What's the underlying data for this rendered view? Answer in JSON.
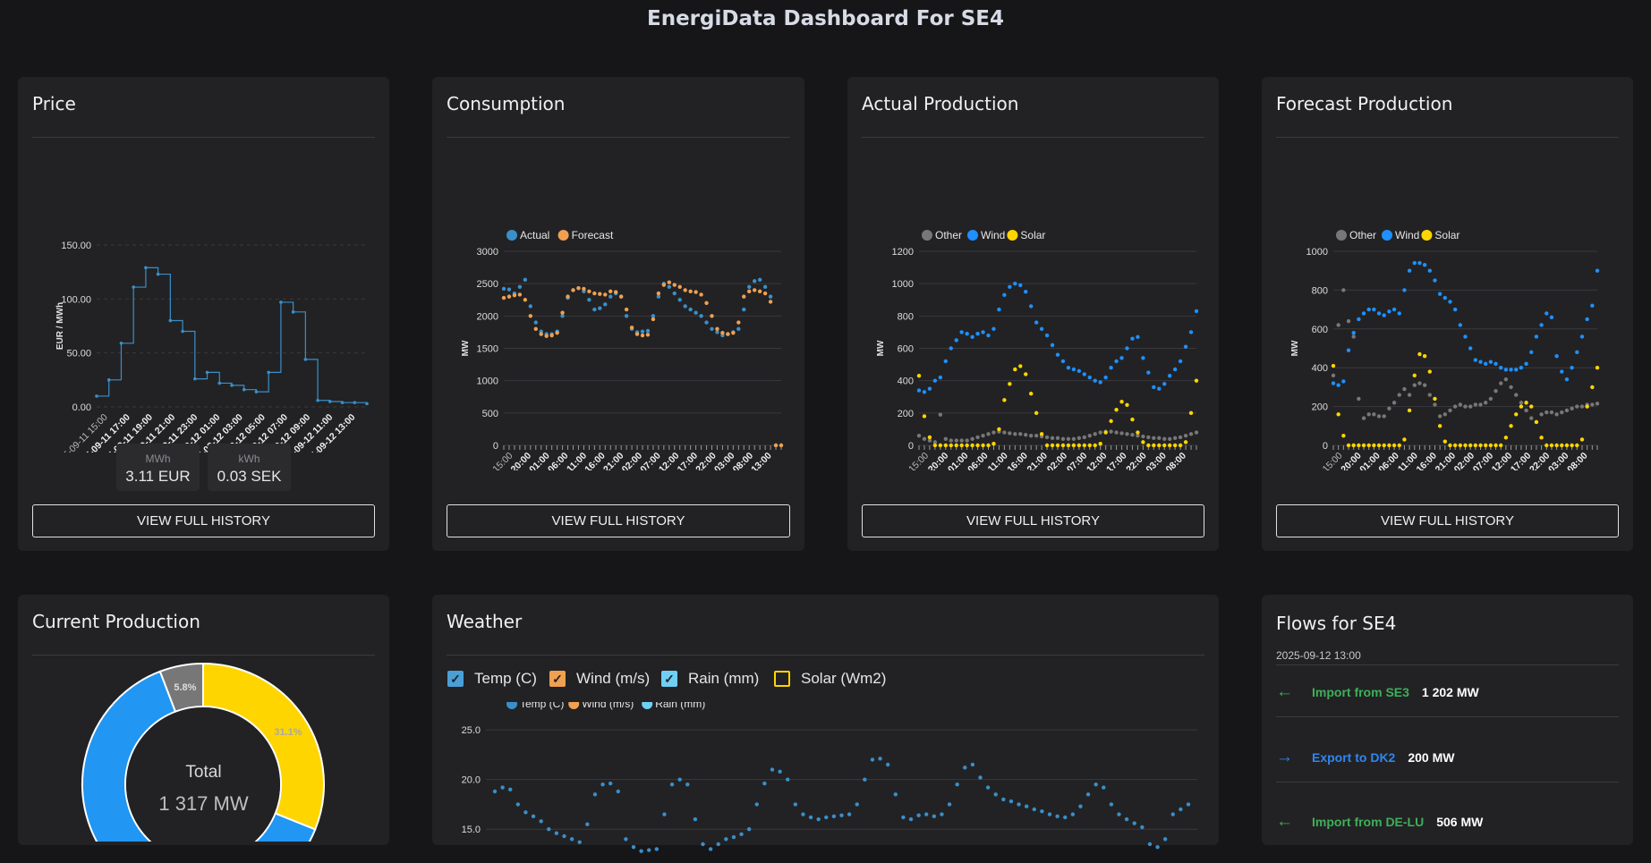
{
  "page": {
    "title": "EnergiData Dashboard For SE4"
  },
  "actions": {
    "history_label": "VIEW FULL HISTORY"
  },
  "colors": {
    "background": "#161618",
    "card": "#222224",
    "series_blue": "#1e90ff",
    "price_blue": "#3a8fc9",
    "forecast_orange": "#f0a050",
    "solar_yellow": "#ffd500",
    "other_gray": "#777777",
    "import_green": "#3fae5a",
    "export_blue": "#2f86f0"
  },
  "price": {
    "title": "Price",
    "boxes": [
      {
        "unit": "MWh",
        "value": "3.11 EUR"
      },
      {
        "unit": "kWh",
        "value": "0.03 SEK"
      }
    ],
    "chart_data": {
      "type": "line",
      "title": "Price",
      "ylabel": "EUR / MWh",
      "ylim": [
        0,
        150
      ],
      "y_ticks": [
        "0.00",
        "50.00",
        "100.00",
        "150.00"
      ],
      "x_ticks": [
        "2025-09-11 15:00",
        "2025-09-11 17:00",
        "2025-09-11 19:00",
        "2025-09-11 21:00",
        "2025-09-11 23:00",
        "2025-09-12 01:00",
        "2025-09-12 03:00",
        "2025-09-12 05:00",
        "2025-09-12 07:00",
        "2025-09-12 09:00",
        "2025-09-12 11:00",
        "2025-09-12 13:00"
      ],
      "step": true,
      "values": [
        10,
        25,
        59,
        111,
        129,
        123,
        80,
        70,
        26,
        32,
        22,
        20,
        16,
        14,
        32,
        97,
        88,
        44,
        6,
        5,
        4,
        4,
        3
      ]
    }
  },
  "consumption": {
    "title": "Consumption",
    "chart_data": {
      "type": "scatter",
      "title": "Consumption",
      "ylabel": "MW",
      "ylim": [
        0,
        3000
      ],
      "y_ticks": [
        "0",
        "500",
        "1000",
        "1500",
        "2000",
        "2500",
        "3000"
      ],
      "x_ticks": [
        "2025-09-09 15:00",
        "2025-09-09 20:00",
        "2025-09-10 01:00",
        "2025-09-10 06:00",
        "2025-09-10 11:00",
        "2025-09-10 16:00",
        "2025-09-10 21:00",
        "2025-09-11 02:00",
        "2025-09-11 07:00",
        "2025-09-11 12:00",
        "2025-09-11 17:00",
        "2025-09-11 22:00",
        "2025-09-12 03:00",
        "2025-09-12 08:00",
        "2025-09-12 13:00"
      ],
      "series": [
        {
          "name": "Actual",
          "color": "#3a8fc9",
          "values": [
            2420,
            2410,
            2350,
            2450,
            2560,
            2150,
            1900,
            1760,
            1720,
            1720,
            1760,
            2000,
            2280,
            2400,
            2430,
            2380,
            2250,
            2100,
            2120,
            2180,
            2300,
            2350,
            2300,
            2000,
            1800,
            1750,
            1760,
            1770,
            2000,
            2300,
            2500,
            2450,
            2350,
            2250,
            2150,
            2100,
            2050,
            2000,
            1900,
            1800,
            1750,
            1700,
            1720,
            1750,
            1800,
            2100,
            2450,
            2540,
            2560,
            2450,
            2300,
            0,
            0
          ]
        },
        {
          "name": "Forecast",
          "color": "#f0a050",
          "values": [
            2280,
            2300,
            2320,
            2330,
            2250,
            2000,
            1800,
            1720,
            1690,
            1700,
            1740,
            2050,
            2300,
            2400,
            2430,
            2420,
            2380,
            2350,
            2340,
            2330,
            2380,
            2370,
            2300,
            2100,
            1820,
            1720,
            1700,
            1710,
            1950,
            2350,
            2480,
            2520,
            2480,
            2450,
            2400,
            2380,
            2370,
            2330,
            2200,
            2000,
            1800,
            1740,
            1720,
            1740,
            1900,
            2300,
            2380,
            2400,
            2380,
            2350,
            2220,
            0,
            0
          ]
        }
      ]
    }
  },
  "actual_production": {
    "title": "Actual Production",
    "chart_data": {
      "type": "scatter",
      "title": "Actual Production",
      "ylabel": "MW",
      "ylim": [
        0,
        1200
      ],
      "y_ticks": [
        "0",
        "200",
        "400",
        "600",
        "800",
        "1000",
        "1200"
      ],
      "x_ticks": [
        "2025-09-09 15:00",
        "2025-09-09 20:00",
        "2025-09-10 01:00",
        "2025-09-10 06:00",
        "2025-09-10 11:00",
        "2025-09-10 16:00",
        "2025-09-10 21:00",
        "2025-09-11 02:00",
        "2025-09-11 07:00",
        "2025-09-11 12:00",
        "2025-09-11 17:00",
        "2025-09-11 22:00",
        "2025-09-12 03:00",
        "2025-09-12 08:00"
      ],
      "series": [
        {
          "name": "Other",
          "color": "#777777",
          "values": [
            60,
            40,
            30,
            20,
            190,
            40,
            30,
            30,
            30,
            30,
            40,
            50,
            60,
            70,
            80,
            85,
            80,
            75,
            70,
            70,
            65,
            60,
            60,
            55,
            50,
            45,
            45,
            40,
            40,
            40,
            45,
            50,
            60,
            70,
            80,
            85,
            85,
            80,
            75,
            70,
            65,
            60,
            55,
            50,
            45,
            45,
            40,
            40,
            45,
            50,
            60,
            70,
            80
          ]
        },
        {
          "name": "Wind",
          "color": "#1e90ff",
          "values": [
            340,
            330,
            350,
            400,
            420,
            520,
            600,
            650,
            700,
            690,
            670,
            690,
            700,
            680,
            720,
            840,
            930,
            980,
            1000,
            990,
            950,
            860,
            760,
            720,
            680,
            620,
            560,
            520,
            480,
            470,
            460,
            440,
            420,
            400,
            390,
            420,
            480,
            520,
            540,
            600,
            660,
            670,
            540,
            450,
            360,
            350,
            380,
            430,
            470,
            520,
            610,
            700,
            830
          ]
        },
        {
          "name": "Solar",
          "color": "#ffd500",
          "values": [
            430,
            180,
            50,
            0,
            0,
            0,
            0,
            0,
            0,
            0,
            0,
            0,
            0,
            0,
            10,
            100,
            280,
            380,
            470,
            490,
            440,
            320,
            200,
            70,
            0,
            0,
            0,
            0,
            0,
            0,
            0,
            0,
            0,
            0,
            10,
            80,
            150,
            220,
            270,
            250,
            160,
            80,
            20,
            0,
            0,
            0,
            0,
            0,
            0,
            0,
            20,
            200,
            400
          ]
        }
      ]
    }
  },
  "forecast_production": {
    "title": "Forecast Production",
    "chart_data": {
      "type": "scatter",
      "title": "Forecast Production",
      "ylabel": "MW",
      "ylim": [
        0,
        1000
      ],
      "y_ticks": [
        "0",
        "200",
        "400",
        "600",
        "800",
        "1000"
      ],
      "x_ticks": [
        "2025-09-09 15:00",
        "2025-09-09 20:00",
        "2025-09-10 01:00",
        "2025-09-10 06:00",
        "2025-09-10 11:00",
        "2025-09-10 16:00",
        "2025-09-10 21:00",
        "2025-09-11 02:00",
        "2025-09-11 07:00",
        "2025-09-11 12:00",
        "2025-09-11 17:00",
        "2025-09-11 22:00",
        "2025-09-12 03:00",
        "2025-09-12 08:00"
      ],
      "series": [
        {
          "name": "Other",
          "color": "#777777",
          "values": [
            360,
            620,
            800,
            640,
            560,
            240,
            140,
            160,
            160,
            150,
            150,
            190,
            220,
            260,
            290,
            260,
            310,
            320,
            310,
            260,
            210,
            150,
            160,
            180,
            200,
            210,
            200,
            200,
            210,
            210,
            220,
            240,
            280,
            320,
            340,
            300,
            260,
            220,
            180,
            140,
            120,
            160,
            170,
            170,
            160,
            170,
            180,
            190,
            200,
            200,
            210,
            210,
            215
          ]
        },
        {
          "name": "Wind",
          "color": "#1e90ff",
          "values": [
            320,
            310,
            330,
            490,
            580,
            650,
            680,
            700,
            700,
            680,
            670,
            690,
            700,
            680,
            800,
            900,
            940,
            940,
            930,
            900,
            850,
            780,
            760,
            740,
            700,
            620,
            560,
            500,
            440,
            430,
            420,
            430,
            420,
            400,
            390,
            390,
            390,
            400,
            420,
            480,
            560,
            620,
            680,
            660,
            460,
            380,
            340,
            400,
            480,
            560,
            650,
            720,
            900
          ]
        },
        {
          "name": "Solar",
          "color": "#ffd500",
          "values": [
            410,
            160,
            50,
            0,
            0,
            0,
            0,
            0,
            0,
            0,
            0,
            0,
            0,
            0,
            30,
            180,
            360,
            470,
            460,
            380,
            240,
            100,
            20,
            0,
            0,
            0,
            0,
            0,
            0,
            0,
            0,
            0,
            0,
            0,
            40,
            100,
            160,
            200,
            220,
            200,
            120,
            40,
            0,
            0,
            0,
            0,
            0,
            0,
            0,
            30,
            200,
            300,
            400
          ]
        }
      ]
    }
  },
  "current_production": {
    "title": "Current Production",
    "total_label": "Total",
    "total_value": "1 317 MW",
    "chart_data": {
      "type": "pie",
      "slices": [
        {
          "label": "Solar",
          "value": 31.1,
          "display": "31.1%",
          "color": "#ffd500"
        },
        {
          "label": "Wind",
          "value": 63.1,
          "display": "",
          "color": "#2196f3"
        },
        {
          "label": "Other",
          "value": 5.8,
          "display": "5.8%",
          "color": "#777777"
        }
      ]
    }
  },
  "weather": {
    "title": "Weather",
    "checkboxes": [
      {
        "label": "Temp (C)",
        "checked": true,
        "color": "#4a9fd6"
      },
      {
        "label": "Wind (m/s)",
        "checked": true,
        "color": "#f0a050"
      },
      {
        "label": "Rain (mm)",
        "checked": true,
        "color": "#6fd0f5"
      },
      {
        "label": "Solar (Wm2)",
        "checked": false,
        "color": "#ffd500"
      }
    ],
    "chart_data": {
      "type": "scatter",
      "legend": [
        "Temp (C)",
        "Wind (m/s)",
        "Rain (mm)"
      ],
      "y_ticks": [
        "15.0",
        "20.0",
        "25.0"
      ],
      "ylim": [
        12.5,
        26
      ],
      "series": [
        {
          "name": "Temp (C)",
          "color": "#3a8fc9",
          "values": [
            18.8,
            19.2,
            19.0,
            17.5,
            16.7,
            16.3,
            15.8,
            15.0,
            14.6,
            14.3,
            14.0,
            13.7,
            15.5,
            18.5,
            19.5,
            19.6,
            18.8,
            14.0,
            13.2,
            12.8,
            12.9,
            13.0,
            16.5,
            19.5,
            20.0,
            19.5,
            16.0,
            13.5,
            13.0,
            13.5,
            14.0,
            14.2,
            14.5,
            15.0,
            17.5,
            19.6,
            21.0,
            20.8,
            20.0,
            17.5,
            16.5,
            16.2,
            16.0,
            16.2,
            16.3,
            16.4,
            16.5,
            17.5,
            20.0,
            22.0,
            22.1,
            21.5,
            18.5,
            16.2,
            16.0,
            16.4,
            16.5,
            16.3,
            16.5,
            17.5,
            19.5,
            21.2,
            21.5,
            20.2,
            19.2,
            18.5,
            18.0,
            17.8,
            17.5,
            17.3,
            17.0,
            16.8,
            16.5,
            16.3,
            16.2,
            16.5,
            17.3,
            18.5,
            19.5,
            19.2,
            17.5,
            16.5,
            16.0,
            15.6,
            15.2,
            13.5,
            13.2,
            14.0,
            16.5,
            17.0,
            17.5
          ]
        }
      ]
    }
  },
  "flows": {
    "title": "Flows for SE4",
    "timestamp": "2025-09-12 13:00",
    "items": [
      {
        "direction": "import",
        "arrow": "arrow-left-icon",
        "label": "Import from SE3",
        "value": "1 202 MW",
        "color": "#3fae5a"
      },
      {
        "direction": "export",
        "arrow": "arrow-right-icon",
        "label": "Export to DK2",
        "value": "200 MW",
        "color": "#2f86f0"
      },
      {
        "direction": "import",
        "arrow": "arrow-left-icon",
        "label": "Import from DE-LU",
        "value": "506 MW",
        "color": "#3fae5a"
      }
    ]
  }
}
